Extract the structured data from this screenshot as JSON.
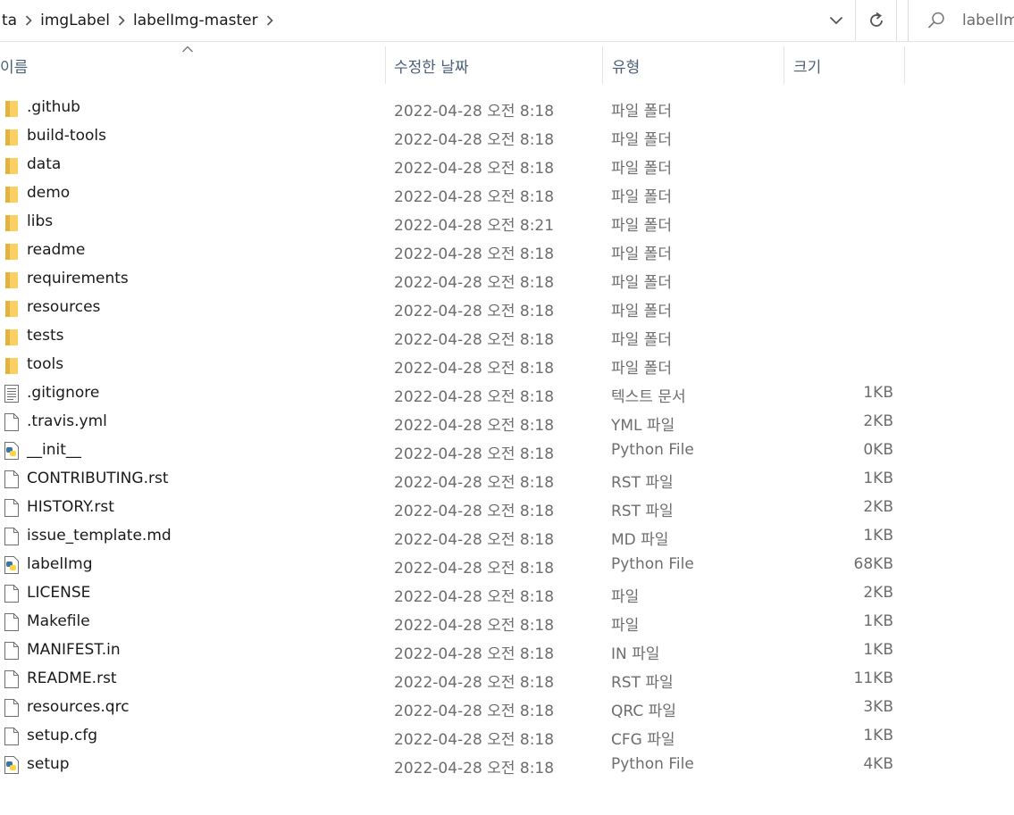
{
  "breadcrumb": [
    "ta",
    "imgLabel",
    "labelImg-master"
  ],
  "search": {
    "placeholder": "labelIm"
  },
  "columns": {
    "name": "이름",
    "date": "수정한 날짜",
    "type": "유형",
    "size": "크기"
  },
  "colors": {
    "folder": "#f8d162",
    "header_text": "#4c607a",
    "secondary_text": "#6d6d6d"
  },
  "files": [
    {
      "name": ".github",
      "date": "2022-04-28 오전 8:18",
      "type": "파일 폴더",
      "size": "",
      "icon": "folder-icon"
    },
    {
      "name": "build-tools",
      "date": "2022-04-28 오전 8:18",
      "type": "파일 폴더",
      "size": "",
      "icon": "folder-icon"
    },
    {
      "name": "data",
      "date": "2022-04-28 오전 8:18",
      "type": "파일 폴더",
      "size": "",
      "icon": "folder-icon"
    },
    {
      "name": "demo",
      "date": "2022-04-28 오전 8:18",
      "type": "파일 폴더",
      "size": "",
      "icon": "folder-icon"
    },
    {
      "name": "libs",
      "date": "2022-04-28 오전 8:21",
      "type": "파일 폴더",
      "size": "",
      "icon": "folder-icon"
    },
    {
      "name": "readme",
      "date": "2022-04-28 오전 8:18",
      "type": "파일 폴더",
      "size": "",
      "icon": "folder-icon"
    },
    {
      "name": "requirements",
      "date": "2022-04-28 오전 8:18",
      "type": "파일 폴더",
      "size": "",
      "icon": "folder-icon"
    },
    {
      "name": "resources",
      "date": "2022-04-28 오전 8:18",
      "type": "파일 폴더",
      "size": "",
      "icon": "folder-icon"
    },
    {
      "name": "tests",
      "date": "2022-04-28 오전 8:18",
      "type": "파일 폴더",
      "size": "",
      "icon": "folder-icon"
    },
    {
      "name": "tools",
      "date": "2022-04-28 오전 8:18",
      "type": "파일 폴더",
      "size": "",
      "icon": "folder-icon"
    },
    {
      "name": ".gitignore",
      "date": "2022-04-28 오전 8:18",
      "type": "텍스트 문서",
      "size": "1KB",
      "icon": "text-file-icon"
    },
    {
      "name": ".travis.yml",
      "date": "2022-04-28 오전 8:18",
      "type": "YML 파일",
      "size": "2KB",
      "icon": "file-icon"
    },
    {
      "name": "__init__",
      "date": "2022-04-28 오전 8:18",
      "type": "Python File",
      "size": "0KB",
      "icon": "python-file-icon"
    },
    {
      "name": "CONTRIBUTING.rst",
      "date": "2022-04-28 오전 8:18",
      "type": "RST 파일",
      "size": "1KB",
      "icon": "file-icon"
    },
    {
      "name": "HISTORY.rst",
      "date": "2022-04-28 오전 8:18",
      "type": "RST 파일",
      "size": "2KB",
      "icon": "file-icon"
    },
    {
      "name": "issue_template.md",
      "date": "2022-04-28 오전 8:18",
      "type": "MD 파일",
      "size": "1KB",
      "icon": "file-icon"
    },
    {
      "name": "labelImg",
      "date": "2022-04-28 오전 8:18",
      "type": "Python File",
      "size": "68KB",
      "icon": "python-file-icon"
    },
    {
      "name": "LICENSE",
      "date": "2022-04-28 오전 8:18",
      "type": "파일",
      "size": "2KB",
      "icon": "file-icon"
    },
    {
      "name": "Makefile",
      "date": "2022-04-28 오전 8:18",
      "type": "파일",
      "size": "1KB",
      "icon": "file-icon"
    },
    {
      "name": "MANIFEST.in",
      "date": "2022-04-28 오전 8:18",
      "type": "IN 파일",
      "size": "1KB",
      "icon": "file-icon"
    },
    {
      "name": "README.rst",
      "date": "2022-04-28 오전 8:18",
      "type": "RST 파일",
      "size": "11KB",
      "icon": "file-icon"
    },
    {
      "name": "resources.qrc",
      "date": "2022-04-28 오전 8:18",
      "type": "QRC 파일",
      "size": "3KB",
      "icon": "file-icon"
    },
    {
      "name": "setup.cfg",
      "date": "2022-04-28 오전 8:18",
      "type": "CFG 파일",
      "size": "1KB",
      "icon": "file-icon"
    },
    {
      "name": "setup",
      "date": "2022-04-28 오전 8:18",
      "type": "Python File",
      "size": "4KB",
      "icon": "python-file-icon"
    }
  ]
}
